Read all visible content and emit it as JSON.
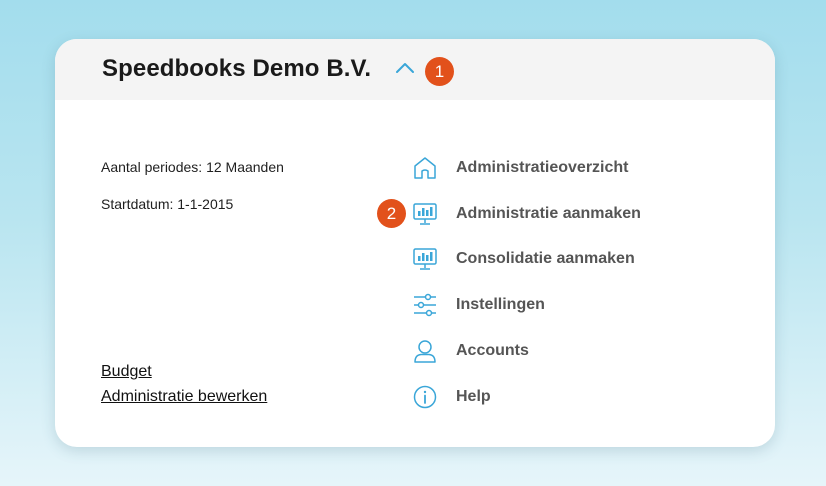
{
  "header": {
    "company_name": "Speedbooks Demo B.V.",
    "badge_1": "1"
  },
  "info": {
    "periods": "Aantal periodes: 12 Maanden",
    "start_date": "Startdatum: 1-1-2015"
  },
  "links": {
    "budget": "Budget",
    "edit_administration": "Administratie bewerken"
  },
  "badge_2": "2",
  "menu": [
    {
      "label": "Administratieoverzicht",
      "icon": "home-icon"
    },
    {
      "label": "Administratie aanmaken",
      "icon": "monitor-chart-icon"
    },
    {
      "label": "Consolidatie aanmaken",
      "icon": "monitor-chart-icon"
    },
    {
      "label": "Instellingen",
      "icon": "sliders-icon"
    },
    {
      "label": "Accounts",
      "icon": "user-icon"
    },
    {
      "label": "Help",
      "icon": "info-icon"
    }
  ],
  "colors": {
    "accent": "#3aa6d8",
    "badge": "#e2511b",
    "header_bg": "#f4f4f4"
  }
}
